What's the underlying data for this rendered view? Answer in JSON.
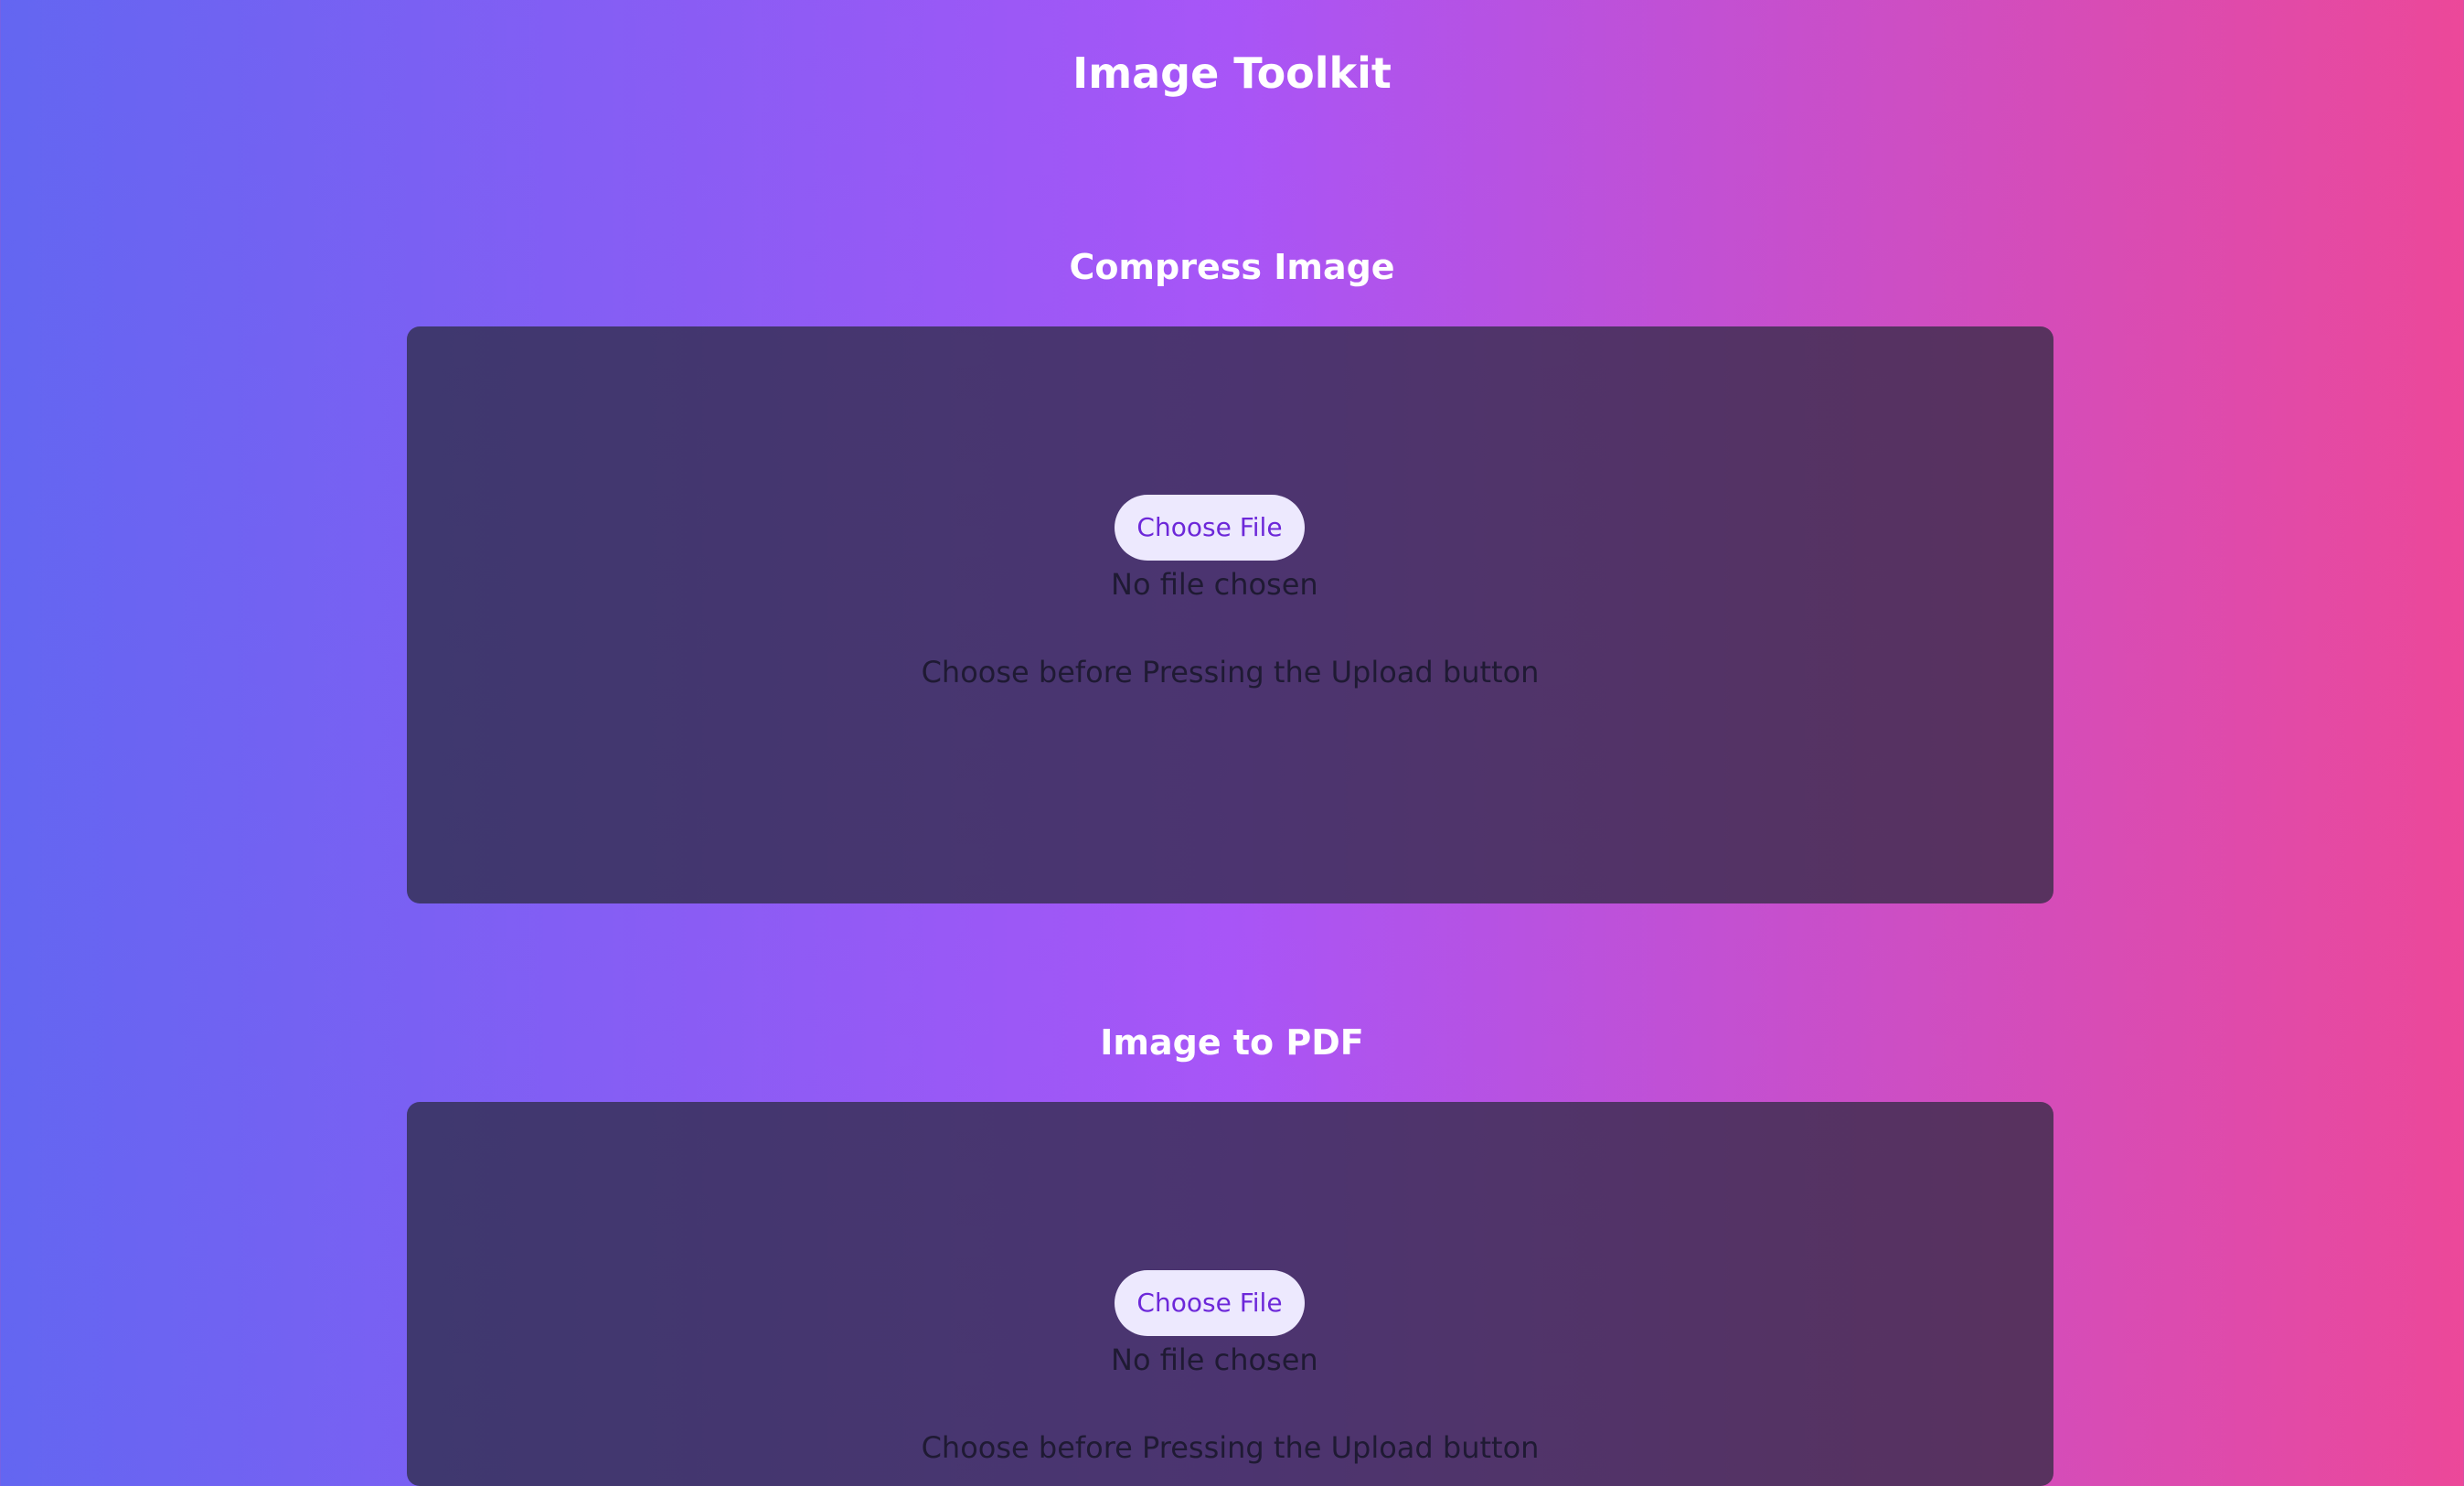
{
  "app": {
    "title": "Image Toolkit"
  },
  "sections": [
    {
      "title": "Compress Image",
      "choose_button_label": "Choose File",
      "file_status": "No file chosen",
      "hint": "Choose before Pressing the Upload button"
    },
    {
      "title": "Image to PDF",
      "choose_button_label": "Choose File",
      "file_status": "No file chosen",
      "hint": "Choose before Pressing the Upload button"
    }
  ],
  "colors": {
    "gradient_start": "#6366f1",
    "gradient_mid": "#a855f7",
    "gradient_end": "#ec4899",
    "card_bg": "#3b3a57",
    "button_bg": "#ede9fe",
    "button_text": "#6d28d9"
  }
}
